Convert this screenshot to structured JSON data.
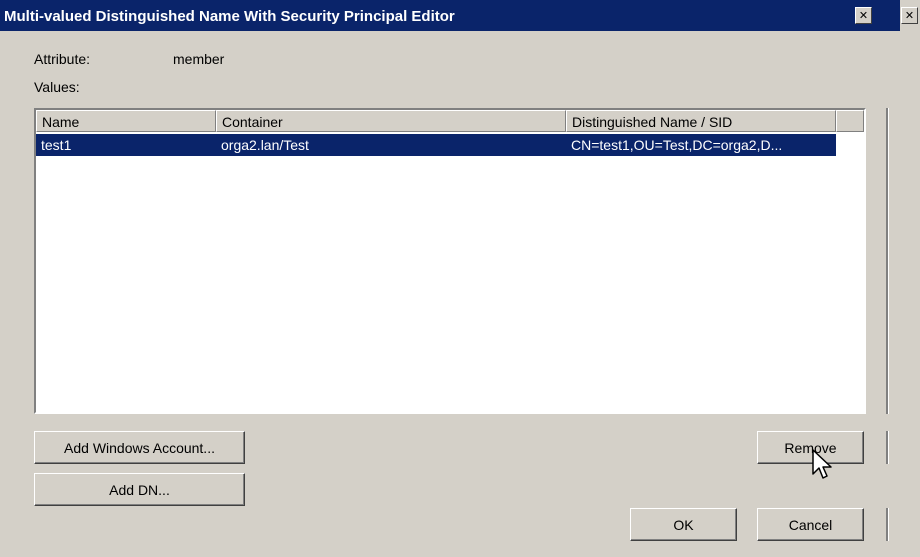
{
  "window": {
    "title": "Multi-valued Distinguished Name With Security Principal Editor",
    "close_glyph": "✕"
  },
  "attribute": {
    "label": "Attribute:",
    "value": "member"
  },
  "values_label": "Values:",
  "list": {
    "columns": [
      "Name",
      "Container",
      "Distinguished Name / SID"
    ],
    "rows": [
      {
        "name": "test1",
        "container": "orga2.lan/Test",
        "dn": "CN=test1,OU=Test,DC=orga2,D..."
      }
    ]
  },
  "buttons": {
    "add_windows_account": "Add Windows Account...",
    "add_dn": "Add DN...",
    "remove": "Remove",
    "ok": "OK",
    "cancel": "Cancel"
  },
  "colors": {
    "titlebar": "#0a246a",
    "selection": "#0a246a",
    "face": "#d4d0c8"
  },
  "icons": {
    "close": "close-icon",
    "cursor": "mouse-pointer-icon"
  }
}
